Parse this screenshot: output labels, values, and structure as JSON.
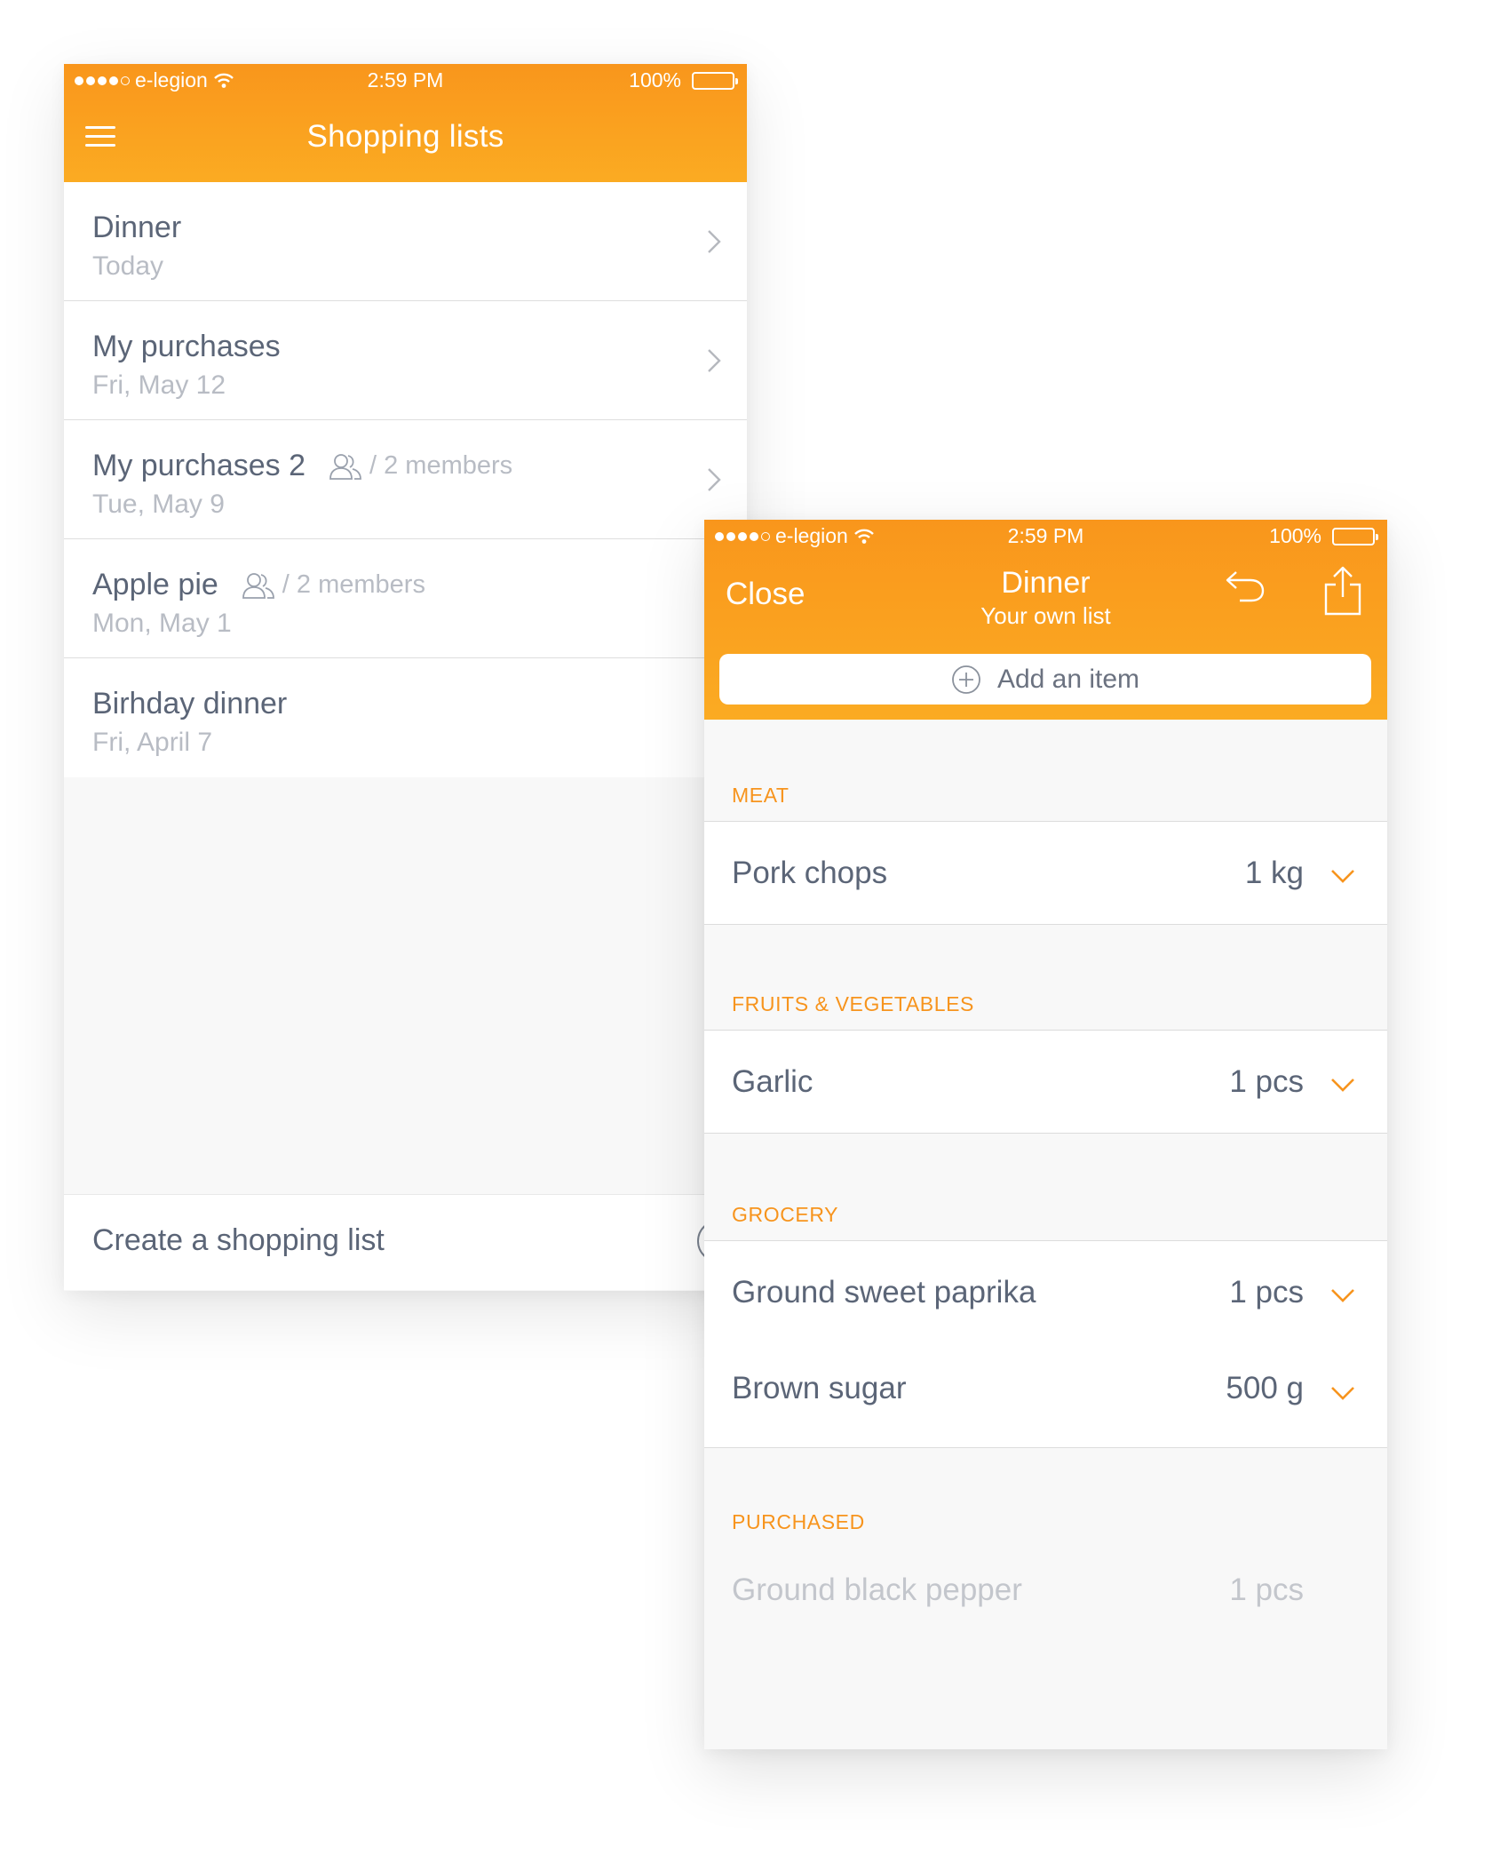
{
  "status_bar": {
    "carrier": "e-legion",
    "time": "2:59 PM",
    "battery": "100%"
  },
  "lists_screen": {
    "title": "Shopping lists",
    "items": [
      {
        "name": "Dinner",
        "date": "Today"
      },
      {
        "name": "My purchases",
        "date": "Fri, May 12"
      },
      {
        "name": "My purchases 2",
        "date": "Tue, May 9",
        "members": "/ 2 members"
      },
      {
        "name": "Apple pie",
        "date": "Mon, May 1",
        "members": "/ 2 members"
      },
      {
        "name": "Birhday dinner",
        "date": "Fri, April 7"
      }
    ],
    "create_label": "Create a shopping list"
  },
  "detail_screen": {
    "close_label": "Close",
    "title": "Dinner",
    "subtitle": "Your own list",
    "add_placeholder": "Add an item",
    "sections": [
      {
        "header": "MEAT",
        "items": [
          {
            "name": "Pork chops",
            "qty": "1 kg"
          }
        ]
      },
      {
        "header": "FRUITS & VEGETABLES",
        "items": [
          {
            "name": "Garlic",
            "qty": "1 pcs"
          }
        ]
      },
      {
        "header": "GROCERY",
        "items": [
          {
            "name": "Ground sweet paprika",
            "qty": "1 pcs"
          },
          {
            "name": "Brown sugar",
            "qty": "500 g"
          }
        ]
      },
      {
        "header": "PURCHASED",
        "items": [
          {
            "name": "Ground black pepper",
            "qty": "1 pcs"
          }
        ]
      }
    ]
  },
  "colors": {
    "accent": "#f7941d",
    "header_top": "#f9961c",
    "header_bottom": "#fbab22",
    "text": "#5b6577",
    "muted": "#b8bcc4"
  },
  "icons": [
    "menu-icon",
    "chevron-right-icon",
    "members-icon",
    "plus-circle-icon",
    "undo-icon",
    "share-icon",
    "chevron-down-icon",
    "wifi-icon",
    "battery-icon"
  ]
}
